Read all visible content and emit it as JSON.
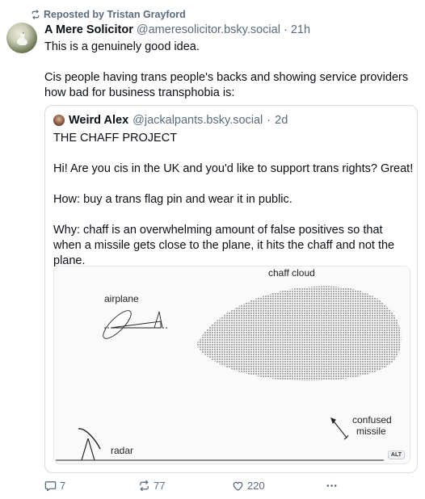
{
  "repost": {
    "label": "Reposted by Tristan Grayford"
  },
  "post": {
    "author_name": "A Mere Solicitor",
    "author_handle": "@ameresolicitor.bsky.social",
    "separator": "·",
    "time": "21h",
    "paragraphs": [
      "This is a genuinely good idea.",
      "Cis people having trans people's backs and showing service providers how bad for business transphobia is:"
    ]
  },
  "quote": {
    "author_name": "Weird Alex",
    "author_handle": "@jackalpants.bsky.social",
    "separator": "·",
    "time": "2d",
    "paragraphs": [
      "THE CHAFF PROJECT",
      "Hi! Are you cis in the UK and you'd like to support trans rights? Great!",
      "How: buy a trans flag pin and wear it in public.",
      "Why: chaff is an overwhelming amount of false positives so that when a missile gets close to the plane, it hits the chaff and not the plane."
    ],
    "image": {
      "labels": {
        "chaff_cloud": "chaff cloud",
        "airplane": "airplane",
        "confused_missile_line1": "confused",
        "confused_missile_line2": "missile",
        "radar": "radar"
      },
      "alt_badge": "ALT"
    }
  },
  "actions": {
    "replies": "7",
    "reposts": "77",
    "likes": "220",
    "more_icon": "ellipsis-icon"
  },
  "colors": {
    "muted": "#5b6b7e",
    "border": "#d4dbe2",
    "text": "#0b0f14"
  }
}
